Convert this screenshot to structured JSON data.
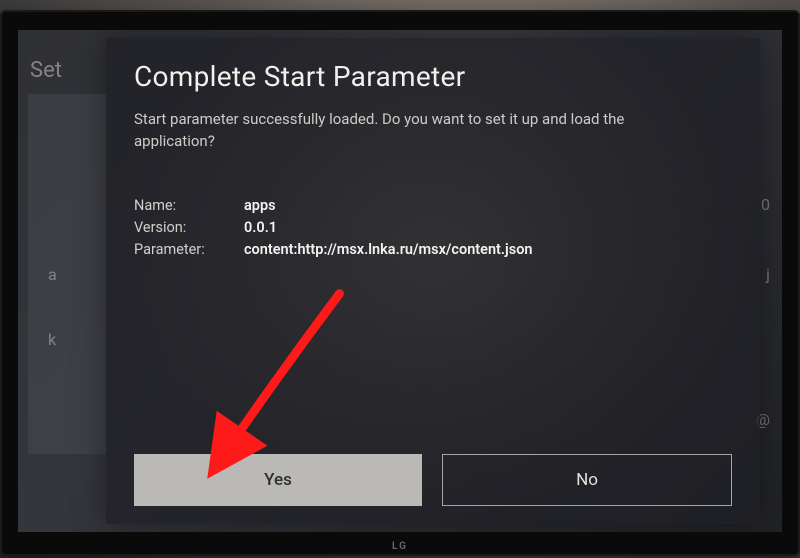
{
  "background": {
    "partial_label": "Set"
  },
  "dialog": {
    "title": "Complete Start Parameter",
    "message": "Start parameter successfully loaded. Do you want to set it up and load the application?",
    "details": {
      "name_label": "Name:",
      "name_value": "apps",
      "version_label": "Version:",
      "version_value": "0.0.1",
      "parameter_label": "Parameter:",
      "parameter_value": "content:http://msx.lnka.ru/msx/content.json"
    },
    "buttons": {
      "yes": "Yes",
      "no": "No"
    }
  },
  "annotation": {
    "arrow_color": "#ff1a1a"
  },
  "tv": {
    "brand": "LG"
  }
}
